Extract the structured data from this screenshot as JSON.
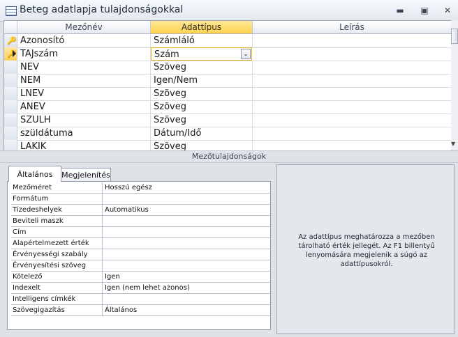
{
  "window": {
    "title": "Beteg adatlapja tulajdonságokkal",
    "controls": {
      "minimize": "▬",
      "restore": "▣",
      "close": "✕"
    }
  },
  "grid": {
    "headers": [
      "Mezőnév",
      "Adattípus",
      "Leírás"
    ],
    "rows": [
      {
        "name": "Azonosító",
        "type": "Számláló"
      },
      {
        "name": "TAJszám",
        "type": "Szám"
      },
      {
        "name": "NEV",
        "type": "Szöveg"
      },
      {
        "name": "NEM",
        "type": "Igen/Nem"
      },
      {
        "name": "LNEV",
        "type": "Szöveg"
      },
      {
        "name": "ANEV",
        "type": "Szöveg"
      },
      {
        "name": "SZULH",
        "type": "Szöveg"
      },
      {
        "name": "szüldátuma",
        "type": "Dátum/Idő"
      },
      {
        "name": "LAKIK",
        "type": "Szöveg"
      }
    ],
    "dropdown_glyph": "⌄"
  },
  "section_title": "Mezőtulajdonságok",
  "tabs": [
    "Általános",
    "Megjelenítés"
  ],
  "properties": [
    {
      "label": "Mezőméret",
      "value": "Hosszú egész"
    },
    {
      "label": "Formátum",
      "value": ""
    },
    {
      "label": "Tizedeshelyek",
      "value": "Automatikus"
    },
    {
      "label": "Beviteli maszk",
      "value": ""
    },
    {
      "label": "Cím",
      "value": ""
    },
    {
      "label": "Alapértelmezett érték",
      "value": ""
    },
    {
      "label": "Érvényességi szabály",
      "value": ""
    },
    {
      "label": "Érvényesítési szöveg",
      "value": ""
    },
    {
      "label": "Kötelező",
      "value": "Igen"
    },
    {
      "label": "Indexelt",
      "value": "Igen (nem lehet azonos)"
    },
    {
      "label": "Intelligens címkék",
      "value": ""
    },
    {
      "label": "Szövegigazítás",
      "value": "Általános"
    }
  ],
  "help_text": "Az adattípus meghatározza a mezőben tárolható érték jellegét. Az F1 billentyű lenyomására megjelenik a súgó az adattípusokról.",
  "icons": {
    "primary_key": "key-icon",
    "current_row": "row-selector-arrow-icon",
    "table": "table-icon"
  },
  "colors": {
    "selected_header": "#ffd24f",
    "active_border": "#e3b21f",
    "key": "#b7891d"
  }
}
